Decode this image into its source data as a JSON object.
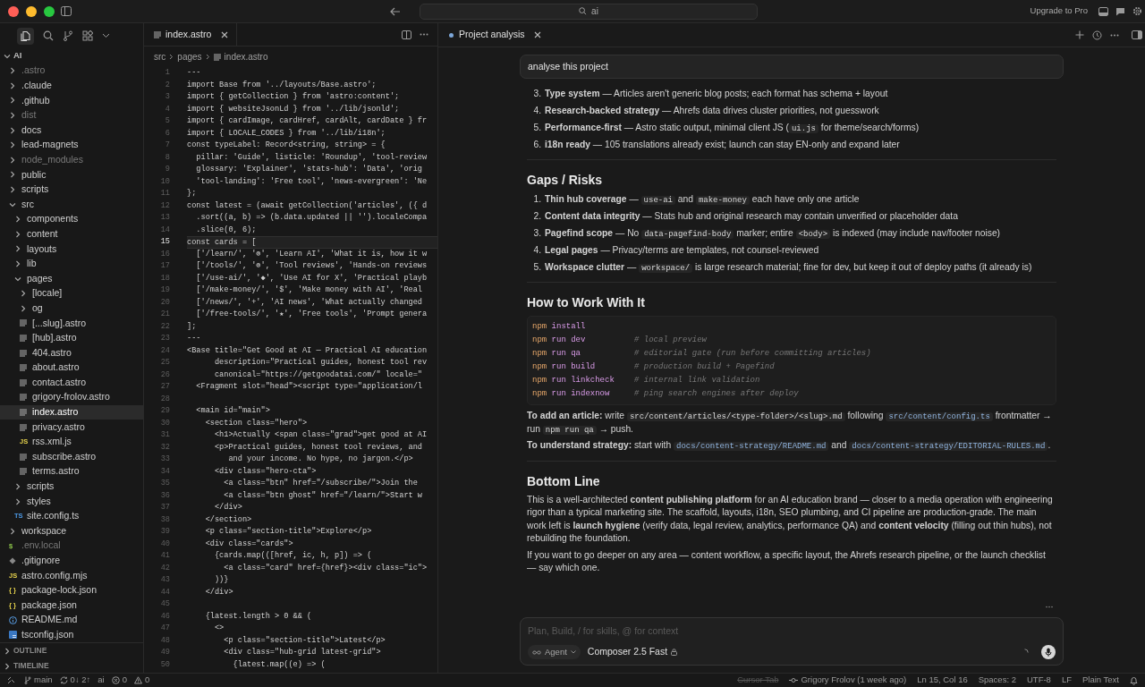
{
  "topbar": {
    "search": {
      "value": "ai"
    },
    "upgrade": "Upgrade to Pro"
  },
  "sidebar": {
    "root": {
      "label": "AI",
      "expanded": true
    },
    "tree": [
      {
        "label": ".astro",
        "kind": "folder",
        "expanded": false,
        "ignored": true,
        "selected": false
      },
      {
        "label": ".claude",
        "kind": "folder",
        "expanded": false,
        "ignored": false,
        "selected": false
      },
      {
        "label": ".github",
        "kind": "folder",
        "expanded": false,
        "ignored": false,
        "selected": false
      },
      {
        "label": "dist",
        "kind": "folder",
        "expanded": false,
        "ignored": true,
        "selected": false
      },
      {
        "label": "docs",
        "kind": "folder",
        "expanded": false,
        "ignored": false,
        "selected": false
      },
      {
        "label": "lead-magnets",
        "kind": "folder",
        "expanded": false,
        "ignored": false,
        "selected": false
      },
      {
        "label": "node_modules",
        "kind": "folder",
        "expanded": false,
        "ignored": true,
        "selected": false
      },
      {
        "label": "public",
        "kind": "folder",
        "expanded": false,
        "ignored": false,
        "selected": false
      },
      {
        "label": "scripts",
        "kind": "folder",
        "expanded": false,
        "ignored": false,
        "selected": false
      },
      {
        "label": "src",
        "kind": "folder",
        "expanded": true,
        "ignored": false,
        "selected": false,
        "children": [
          {
            "label": "components",
            "kind": "folder",
            "expanded": false,
            "ignored": false,
            "selected": false
          },
          {
            "label": "content",
            "kind": "folder",
            "expanded": false,
            "ignored": false,
            "selected": false
          },
          {
            "label": "layouts",
            "kind": "folder",
            "expanded": false,
            "ignored": false,
            "selected": false
          },
          {
            "label": "lib",
            "kind": "folder",
            "expanded": false,
            "ignored": false,
            "selected": false
          },
          {
            "label": "pages",
            "kind": "folder",
            "expanded": true,
            "ignored": false,
            "selected": false,
            "children": [
              {
                "label": "[locale]",
                "kind": "folder",
                "expanded": false,
                "ignored": false,
                "selected": false
              },
              {
                "label": "og",
                "kind": "folder",
                "expanded": false,
                "ignored": false,
                "selected": false
              },
              {
                "label": "[...slug].astro",
                "kind": "astro",
                "ignored": false,
                "selected": false
              },
              {
                "label": "[hub].astro",
                "kind": "astro",
                "ignored": false,
                "selected": false
              },
              {
                "label": "404.astro",
                "kind": "astro",
                "ignored": false,
                "selected": false
              },
              {
                "label": "about.astro",
                "kind": "astro",
                "ignored": false,
                "selected": false
              },
              {
                "label": "contact.astro",
                "kind": "astro",
                "ignored": false,
                "selected": false
              },
              {
                "label": "grigory-frolov.astro",
                "kind": "astro",
                "ignored": false,
                "selected": false
              },
              {
                "label": "index.astro",
                "kind": "astro",
                "ignored": false,
                "selected": true
              },
              {
                "label": "privacy.astro",
                "kind": "astro",
                "ignored": false,
                "selected": false
              },
              {
                "label": "rss.xml.js",
                "kind": "js",
                "badge": "JS",
                "ignored": false,
                "selected": false
              },
              {
                "label": "subscribe.astro",
                "kind": "astro",
                "ignored": false,
                "selected": false
              },
              {
                "label": "terms.astro",
                "kind": "astro",
                "ignored": false,
                "selected": false
              }
            ]
          },
          {
            "label": "scripts",
            "kind": "folder",
            "expanded": false,
            "ignored": false,
            "selected": false
          },
          {
            "label": "styles",
            "kind": "folder",
            "expanded": false,
            "ignored": false,
            "selected": false
          },
          {
            "label": "site.config.ts",
            "kind": "ts",
            "badge": "TS",
            "ignored": false,
            "selected": false
          }
        ]
      },
      {
        "label": "workspace",
        "kind": "folder",
        "expanded": false,
        "ignored": false,
        "selected": false
      },
      {
        "label": ".env.local",
        "kind": "env",
        "badge": "$",
        "ignored": true,
        "selected": false
      },
      {
        "label": ".gitignore",
        "kind": "git",
        "ignored": false,
        "selected": false
      },
      {
        "label": "astro.config.mjs",
        "kind": "js",
        "badge": "JS",
        "ignored": false,
        "selected": false
      },
      {
        "label": "package-lock.json",
        "kind": "json",
        "badge": "{ }",
        "ignored": false,
        "selected": false
      },
      {
        "label": "package.json",
        "kind": "json",
        "badge": "{ }",
        "ignored": false,
        "selected": false
      },
      {
        "label": "README.md",
        "kind": "info",
        "ignored": false,
        "selected": false
      },
      {
        "label": "tsconfig.json",
        "kind": "tsconfig",
        "ignored": false,
        "selected": false
      }
    ],
    "panels": [
      {
        "label": "OUTLINE",
        "expanded": false
      },
      {
        "label": "TIMELINE",
        "expanded": false
      }
    ]
  },
  "editor": {
    "tab": {
      "label": "index.astro"
    },
    "breadcrumb": [
      "src",
      "pages",
      "index.astro"
    ],
    "lines": [
      {
        "n": "1",
        "text": "---",
        "current": false
      },
      {
        "n": "2",
        "text": "import Base from '../layouts/Base.astro';",
        "current": false
      },
      {
        "n": "3",
        "text": "import { getCollection } from 'astro:content';",
        "current": false
      },
      {
        "n": "4",
        "text": "import { websiteJsonLd } from '../lib/jsonld';",
        "current": false
      },
      {
        "n": "5",
        "text": "import { cardImage, cardHref, cardAlt, cardDate } fr",
        "current": false
      },
      {
        "n": "6",
        "text": "import { LOCALE_CODES } from '../lib/i18n';",
        "current": false
      },
      {
        "n": "7",
        "text": "const typeLabel: Record<string, string> = {",
        "current": false
      },
      {
        "n": "8",
        "text": "  pillar: 'Guide', listicle: 'Roundup', 'tool-review",
        "current": false
      },
      {
        "n": "9",
        "text": "  glossary: 'Explainer', 'stats-hub': 'Data', 'orig",
        "current": false
      },
      {
        "n": "10",
        "text": "  'tool-landing': 'Free tool', 'news-evergreen': 'Ne",
        "current": false
      },
      {
        "n": "11",
        "text": "};",
        "current": false
      },
      {
        "n": "12",
        "text": "const latest = (await getCollection('articles', ({ d",
        "current": false
      },
      {
        "n": "13",
        "text": "  .sort((a, b) => (b.data.updated || '').localeCompa",
        "current": false
      },
      {
        "n": "14",
        "text": "  .slice(0, 6);",
        "current": false
      },
      {
        "n": "15",
        "text": "const cards = [",
        "current": true
      },
      {
        "n": "16",
        "text": "  ['/learn/', '⊚', 'Learn AI', 'What it is, how it w",
        "current": false
      },
      {
        "n": "17",
        "text": "  ['/tools/', '⊚', 'Tool reviews', 'Hands-on reviews",
        "current": false
      },
      {
        "n": "18",
        "text": "  ['/use-ai/', '◆', 'Use AI for X', 'Practical playb",
        "current": false
      },
      {
        "n": "19",
        "text": "  ['/make-money/', '$', 'Make money with AI', 'Real",
        "current": false
      },
      {
        "n": "20",
        "text": "  ['/news/', '+', 'AI news', 'What actually changed",
        "current": false
      },
      {
        "n": "21",
        "text": "  ['/free-tools/', '★', 'Free tools', 'Prompt genera",
        "current": false
      },
      {
        "n": "22",
        "text": "];",
        "current": false
      },
      {
        "n": "23",
        "text": "---",
        "current": false
      },
      {
        "n": "24",
        "text": "<Base title=\"Get Good at AI — Practical AI education",
        "current": false
      },
      {
        "n": "25",
        "text": "      description=\"Practical guides, honest tool rev",
        "current": false
      },
      {
        "n": "26",
        "text": "      canonical=\"https://getgoodatai.com/\" locale=\"",
        "current": false
      },
      {
        "n": "27",
        "text": "  <Fragment slot=\"head\"><script type=\"application/l",
        "current": false
      },
      {
        "n": "28",
        "current": false
      },
      {
        "n": "29",
        "text": "  <main id=\"main\">",
        "current": false
      },
      {
        "n": "30",
        "text": "    <section class=\"hero\">",
        "current": false
      },
      {
        "n": "31",
        "text": "      <h1>Actually <span class=\"grad\">get good at AI",
        "current": false
      },
      {
        "n": "32",
        "text": "      <p>Practical guides, honest tool reviews, and",
        "current": false
      },
      {
        "n": "33",
        "text": "         and your income. No hype, no jargon.</p>",
        "current": false
      },
      {
        "n": "34",
        "text": "      <div class=\"hero-cta\">",
        "current": false
      },
      {
        "n": "35",
        "text": "        <a class=\"btn\" href=\"/subscribe/\">Join the",
        "current": false
      },
      {
        "n": "36",
        "text": "        <a class=\"btn ghost\" href=\"/learn/\">Start w",
        "current": false
      },
      {
        "n": "37",
        "text": "      </div>",
        "current": false
      },
      {
        "n": "38",
        "text": "    </section>",
        "current": false
      },
      {
        "n": "39",
        "text": "    <p class=\"section-title\">Explore</p>",
        "current": false
      },
      {
        "n": "40",
        "text": "    <div class=\"cards\">",
        "current": false
      },
      {
        "n": "41",
        "text": "      {cards.map(([href, ic, h, p]) => (",
        "current": false
      },
      {
        "n": "42",
        "text": "        <a class=\"card\" href={href}><div class=\"ic\">",
        "current": false
      },
      {
        "n": "43",
        "text": "      ))}",
        "current": false
      },
      {
        "n": "44",
        "text": "    </div>",
        "current": false
      },
      {
        "n": "45",
        "current": false
      },
      {
        "n": "46",
        "text": "    {latest.length > 0 && (",
        "current": false
      },
      {
        "n": "47",
        "text": "      <>",
        "current": false
      },
      {
        "n": "48",
        "text": "        <p class=\"section-title\">Latest</p>",
        "current": false
      },
      {
        "n": "49",
        "text": "        <div class=\"hub-grid latest-grid\">",
        "current": false
      },
      {
        "n": "50",
        "text": "          {latest.map((e) => (",
        "current": false
      }
    ]
  },
  "chat": {
    "tab": {
      "label": "Project analysis"
    },
    "prompt": "analyse this project",
    "blocks": [
      {
        "kind": "list",
        "items": [
          {
            "number": "3.",
            "parts": [
              {
                "kind": "text",
                "text": "**Type system** — Articles aren't generic blog posts; each format has schema + layout"
              }
            ]
          },
          {
            "number": "4.",
            "parts": [
              {
                "kind": "text",
                "text": "**Research-backed strategy** — Ahrefs data drives cluster priorities, not guesswork"
              }
            ]
          },
          {
            "number": "5.",
            "parts": [
              {
                "kind": "text",
                "text": "**Performance-first** — Astro static output, minimal client JS ("
              },
              {
                "kind": "code",
                "text": "ui.js"
              },
              {
                "kind": "text",
                "text": " for theme/search/forms)"
              }
            ]
          },
          {
            "number": "6.",
            "parts": [
              {
                "kind": "text",
                "text": "**i18n ready** — 105 translations already exist; launch can stay EN-only and expand later"
              }
            ]
          }
        ]
      },
      {
        "kind": "rule"
      },
      {
        "kind": "heading",
        "text": "Gaps / Risks"
      },
      {
        "kind": "list",
        "items": [
          {
            "number": "1.",
            "parts": [
              {
                "kind": "text",
                "text": "**Thin hub coverage** — "
              },
              {
                "kind": "code",
                "text": "use-ai"
              },
              {
                "kind": "text",
                "text": " and "
              },
              {
                "kind": "code",
                "text": "make-money"
              },
              {
                "kind": "text",
                "text": " each have only one article"
              }
            ]
          },
          {
            "number": "2.",
            "parts": [
              {
                "kind": "text",
                "text": "**Content data integrity** — Stats hub and original research may contain unverified or placeholder data"
              }
            ]
          },
          {
            "number": "3.",
            "parts": [
              {
                "kind": "text",
                "text": "**Pagefind scope** — No "
              },
              {
                "kind": "code",
                "text": "data-pagefind-body"
              },
              {
                "kind": "text",
                "text": " marker; entire "
              },
              {
                "kind": "code",
                "text": "<body>"
              },
              {
                "kind": "text",
                "text": " is indexed (may include nav/footer noise)"
              }
            ]
          },
          {
            "number": "4.",
            "parts": [
              {
                "kind": "text",
                "text": "**Legal pages** — Privacy/terms are templates, not counsel-reviewed"
              }
            ]
          },
          {
            "number": "5.",
            "parts": [
              {
                "kind": "text",
                "text": "**Workspace clutter** — "
              },
              {
                "kind": "code",
                "text": "workspace/"
              },
              {
                "kind": "text",
                "text": " is large research material; fine for dev, but keep it out of deploy paths (it already is)"
              }
            ]
          }
        ]
      },
      {
        "kind": "rule"
      },
      {
        "kind": "heading",
        "text": "How to Work With It"
      },
      {
        "kind": "code",
        "lines": [
          [
            {
              "kind": "cmd",
              "text": "npm"
            },
            {
              "kind": "arg",
              "text": "install"
            }
          ],
          [
            {
              "kind": "cmd",
              "text": "npm"
            },
            {
              "kind": "arg",
              "text": "run dev"
            },
            {
              "kind": "comment",
              "text": "# local preview"
            }
          ],
          [
            {
              "kind": "cmd",
              "text": "npm"
            },
            {
              "kind": "arg",
              "text": "run qa"
            },
            {
              "kind": "comment",
              "text": "# editorial gate (run before committing articles)"
            }
          ],
          [
            {
              "kind": "cmd",
              "text": "npm"
            },
            {
              "kind": "arg",
              "text": "run build"
            },
            {
              "kind": "comment",
              "text": "# production build + Pagefind"
            }
          ],
          [
            {
              "kind": "cmd",
              "text": "npm"
            },
            {
              "kind": "arg",
              "text": "run linkcheck"
            },
            {
              "kind": "comment",
              "text": "# internal link validation"
            }
          ],
          [
            {
              "kind": "cmd",
              "text": "npm"
            },
            {
              "kind": "arg",
              "text": "run indexnow"
            },
            {
              "kind": "comment",
              "text": "# ping search engines after deploy"
            }
          ]
        ]
      },
      {
        "kind": "paragraph",
        "parts": [
          {
            "kind": "text",
            "text": "**To add an article:** write "
          },
          {
            "kind": "code",
            "text": "src/content/articles/<type-folder>/<slug>.md"
          },
          {
            "kind": "text",
            "text": " following "
          },
          {
            "kind": "code_link",
            "text": "src/content/config.ts"
          },
          {
            "kind": "text",
            "text": " frontmatter → run "
          },
          {
            "kind": "code",
            "text": "npm run qa"
          },
          {
            "kind": "text",
            "text": " → push."
          }
        ]
      },
      {
        "kind": "paragraph",
        "parts": [
          {
            "kind": "text",
            "text": "**To understand strategy:** start with "
          },
          {
            "kind": "code_link",
            "text": "docs/content-strategy/README.md"
          },
          {
            "kind": "text",
            "text": " and "
          },
          {
            "kind": "code_link",
            "text": "docs/content-strategy/EDITORIAL-RULES.md"
          },
          {
            "kind": "text",
            "text": "."
          }
        ]
      },
      {
        "kind": "rule"
      },
      {
        "kind": "heading",
        "text": "Bottom Line"
      },
      {
        "kind": "paragraph",
        "parts": [
          {
            "kind": "text",
            "text": "This is a well-architected **content publishing platform** for an AI education brand — closer to a media operation with engineering rigor than a typical marketing site. The scaffold, layouts, i18n, SEO plumbing, and CI pipeline are production-grade. The main work left is **launch hygiene** (verify data, legal review, analytics, performance QA) and **content velocity** (filling out thin hubs), not rebuilding the foundation."
          }
        ]
      },
      {
        "kind": "paragraph",
        "parts": [
          {
            "kind": "text",
            "text": "If you want to go deeper on any area — content workflow, a specific layout, the Ahrefs research pipeline, or the launch checklist — say which one."
          }
        ]
      }
    ],
    "composer": {
      "placeholder": "Plan, Build, / for skills, @ for context",
      "mode": "Agent",
      "model": "Composer 2.5 Fast"
    }
  },
  "status_bar": {
    "left": [
      {
        "kind": "branch",
        "text": "main"
      },
      {
        "kind": "sync",
        "text": "0↓ 2↑"
      },
      {
        "kind": "plain",
        "text": "ai"
      },
      {
        "kind": "errors",
        "text": "0"
      },
      {
        "kind": "warnings",
        "text": "0"
      }
    ],
    "right": [
      {
        "kind": "plain",
        "text": "Cursor Tab",
        "disabled": true
      },
      {
        "kind": "blame",
        "text": "Grigory Frolov (1 week ago)",
        "disabled": false
      },
      {
        "kind": "plain",
        "text": "Ln 15, Col 16",
        "disabled": false
      },
      {
        "kind": "plain",
        "text": "Spaces: 2",
        "disabled": false
      },
      {
        "kind": "plain",
        "text": "UTF-8",
        "disabled": false
      },
      {
        "kind": "plain",
        "text": "LF",
        "disabled": false
      },
      {
        "kind": "plain",
        "text": "Plain Text",
        "disabled": false
      }
    ]
  }
}
